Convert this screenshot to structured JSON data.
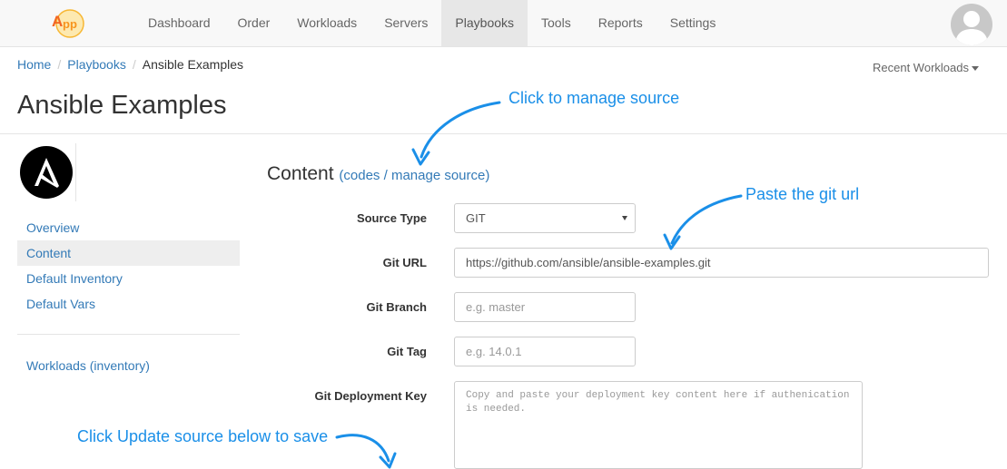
{
  "nav": {
    "links": [
      "Dashboard",
      "Order",
      "Workloads",
      "Servers",
      "Playbooks",
      "Tools",
      "Reports",
      "Settings"
    ],
    "active": "Playbooks"
  },
  "breadcrumb": {
    "home": "Home",
    "playbooks": "Playbooks",
    "current": "Ansible Examples"
  },
  "recent_workloads": "Recent Workloads",
  "page_title": "Ansible Examples",
  "sidebar": {
    "items": [
      "Overview",
      "Content",
      "Default Inventory",
      "Default Vars"
    ],
    "active": "Content",
    "secondary": "Workloads (inventory)"
  },
  "content": {
    "heading": "Content",
    "codes_link": "codes",
    "slash": " / ",
    "manage_link": "manage source"
  },
  "form": {
    "source_type_label": "Source Type",
    "source_type_value": "GIT",
    "git_url_label": "Git URL",
    "git_url_value": "https://github.com/ansible/ansible-examples.git",
    "git_branch_label": "Git Branch",
    "git_branch_placeholder": "e.g. master",
    "git_tag_label": "Git Tag",
    "git_tag_placeholder": "e.g. 14.0.1",
    "deploy_key_label": "Git Deployment Key",
    "deploy_key_placeholder": "Copy and paste your deployment key content here if authenication is needed."
  },
  "annotations": {
    "manage_source": "Click to manage source",
    "paste_git": "Paste the git url",
    "update_source": "Click Update source below to save"
  },
  "colors": {
    "link": "#337ab7",
    "annotation": "#1a8fe8",
    "logo_orange": "#f7941d"
  }
}
